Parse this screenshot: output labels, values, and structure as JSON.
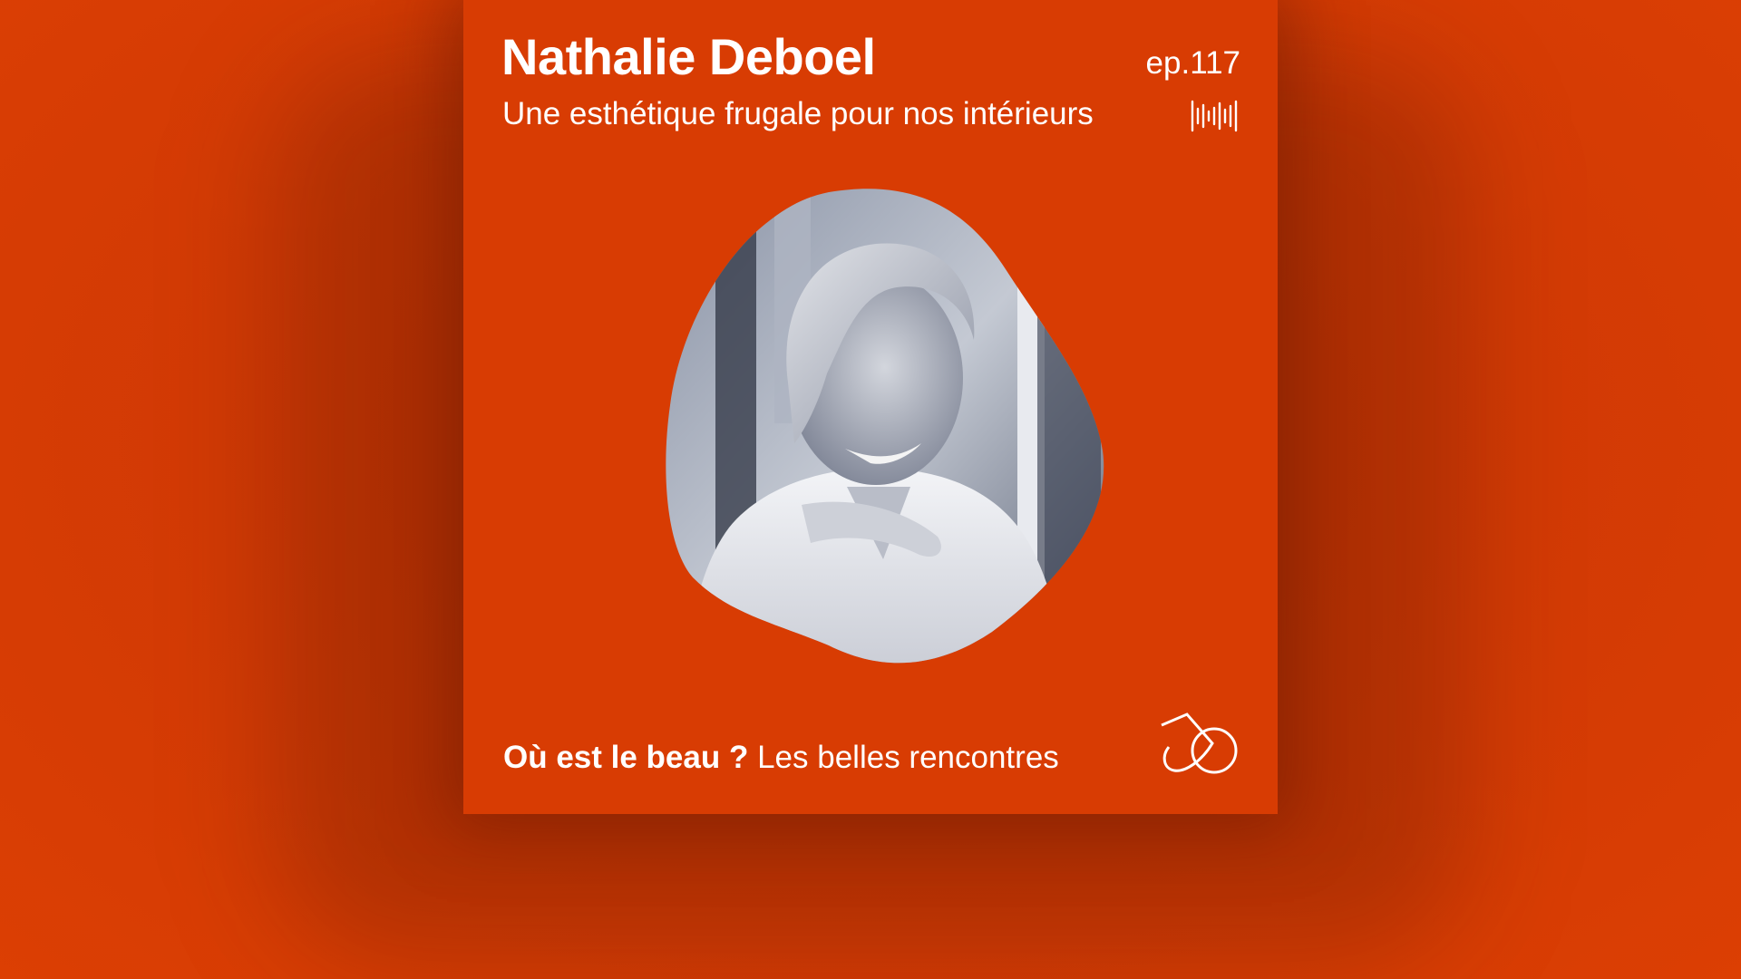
{
  "podcast_cover": {
    "guest_name": "Nathalie Deboel",
    "episode_title": "Une esthétique frugale pour nos intérieurs",
    "episode_number": "ep.117",
    "show_name": "Où est le beau ?",
    "show_segment": "Les belles rencontres",
    "accent_color": "#d83c03",
    "text_color": "#ffffff",
    "icons": [
      "waveform-icon",
      "brand-logo"
    ]
  },
  "audio_visualizer": {
    "colors": [
      "#e2a8ff",
      "#9a72f4",
      "#6d86e6",
      "#b07ad8"
    ]
  }
}
